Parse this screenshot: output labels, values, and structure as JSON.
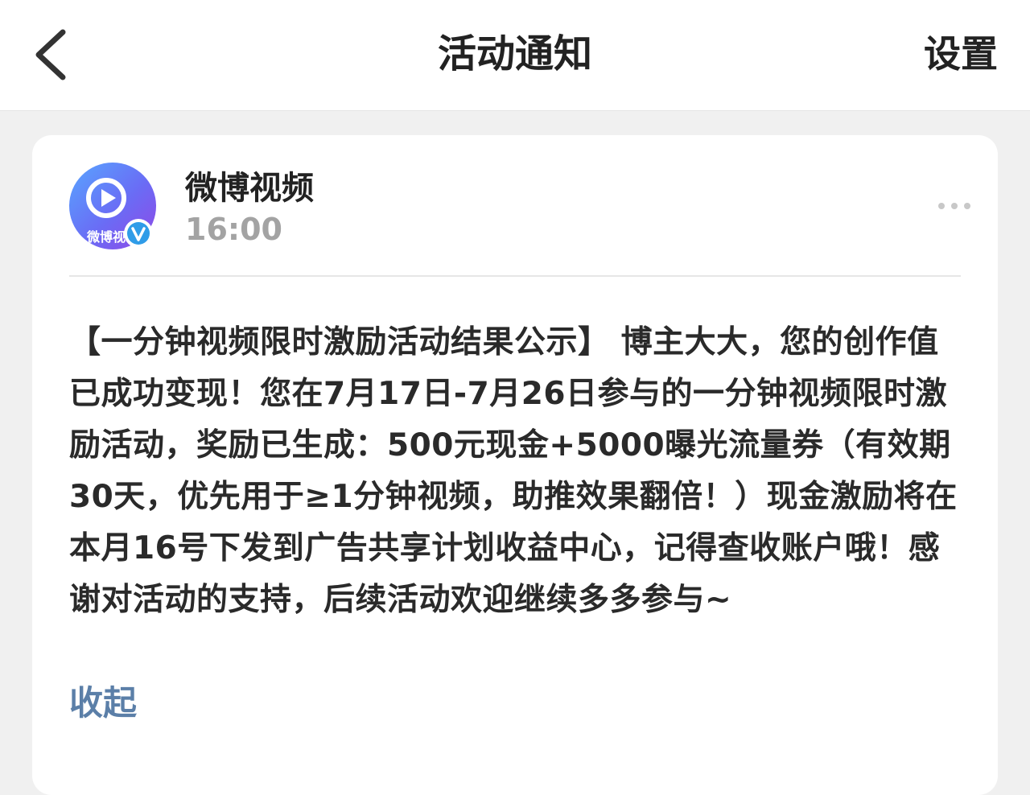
{
  "nav": {
    "title": "活动通知",
    "settings_label": "设置"
  },
  "message": {
    "sender": "微博视频",
    "avatar_text": "微博视",
    "time": "16:00",
    "body": "【一分钟视频限时激励活动结果公示】 博主大大，您的创作值已成功变现！您在7月17日-7月26日参与的一分钟视频限时激励活动，奖励已生成：500元现金+5000曝光流量券（有效期30天，优先用于≥1分钟视频，助推效果翻倍！）现金激励将在本月16号下发到广告共享计划收益中心，记得查收账户哦！感谢对活动的支持，后续活动欢迎继续多多参与~",
    "collapse_label": "收起"
  },
  "colors": {
    "link": "#5b7fa8",
    "verified_badge": "#2f9ce8",
    "avatar_gradient": [
      "#5c8cf7",
      "#8b4fe8"
    ]
  },
  "icons": [
    "back-chevron-icon",
    "play-icon",
    "verified-v-icon",
    "more-dots-icon"
  ]
}
